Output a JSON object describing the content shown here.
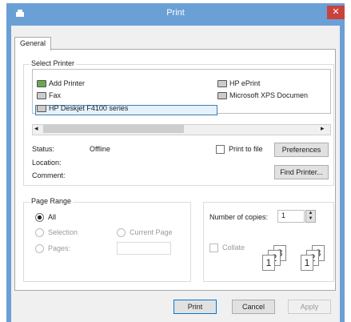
{
  "window": {
    "title": "Print",
    "close_glyph": "✕"
  },
  "tabs": [
    {
      "label": "General"
    }
  ],
  "select_printer": {
    "legend": "Select Printer",
    "printers": [
      {
        "name": "Add Printer"
      },
      {
        "name": "Fax"
      },
      {
        "name": "HP Deskjet F4100 series",
        "selected": true
      },
      {
        "name": "HP ePrint"
      },
      {
        "name": "Microsoft XPS Documen"
      }
    ],
    "scroll_left": "◂",
    "scroll_right": "▸",
    "status_label": "Status:",
    "status_value": "Offline",
    "location_label": "Location:",
    "comment_label": "Comment:",
    "print_to_file_label": "Print to file",
    "preferences_label": "Preferences",
    "find_printer_label": "Find Printer..."
  },
  "page_range": {
    "legend": "Page Range",
    "all_label": "All",
    "selection_label": "Selection",
    "current_page_label": "Current Page",
    "pages_label": "Pages:"
  },
  "copies": {
    "label": "Number of copies:",
    "value": "1",
    "collate_label": "Collate",
    "stack1": [
      "1",
      "2",
      "3"
    ],
    "stack2": [
      "1",
      "2",
      "3"
    ]
  },
  "footer": {
    "print_label": "Print",
    "cancel_label": "Cancel",
    "apply_label": "Apply"
  },
  "colors": {
    "titlebar": "#6ba0d6",
    "close": "#c9423c",
    "selection": "#e5f1fb"
  }
}
